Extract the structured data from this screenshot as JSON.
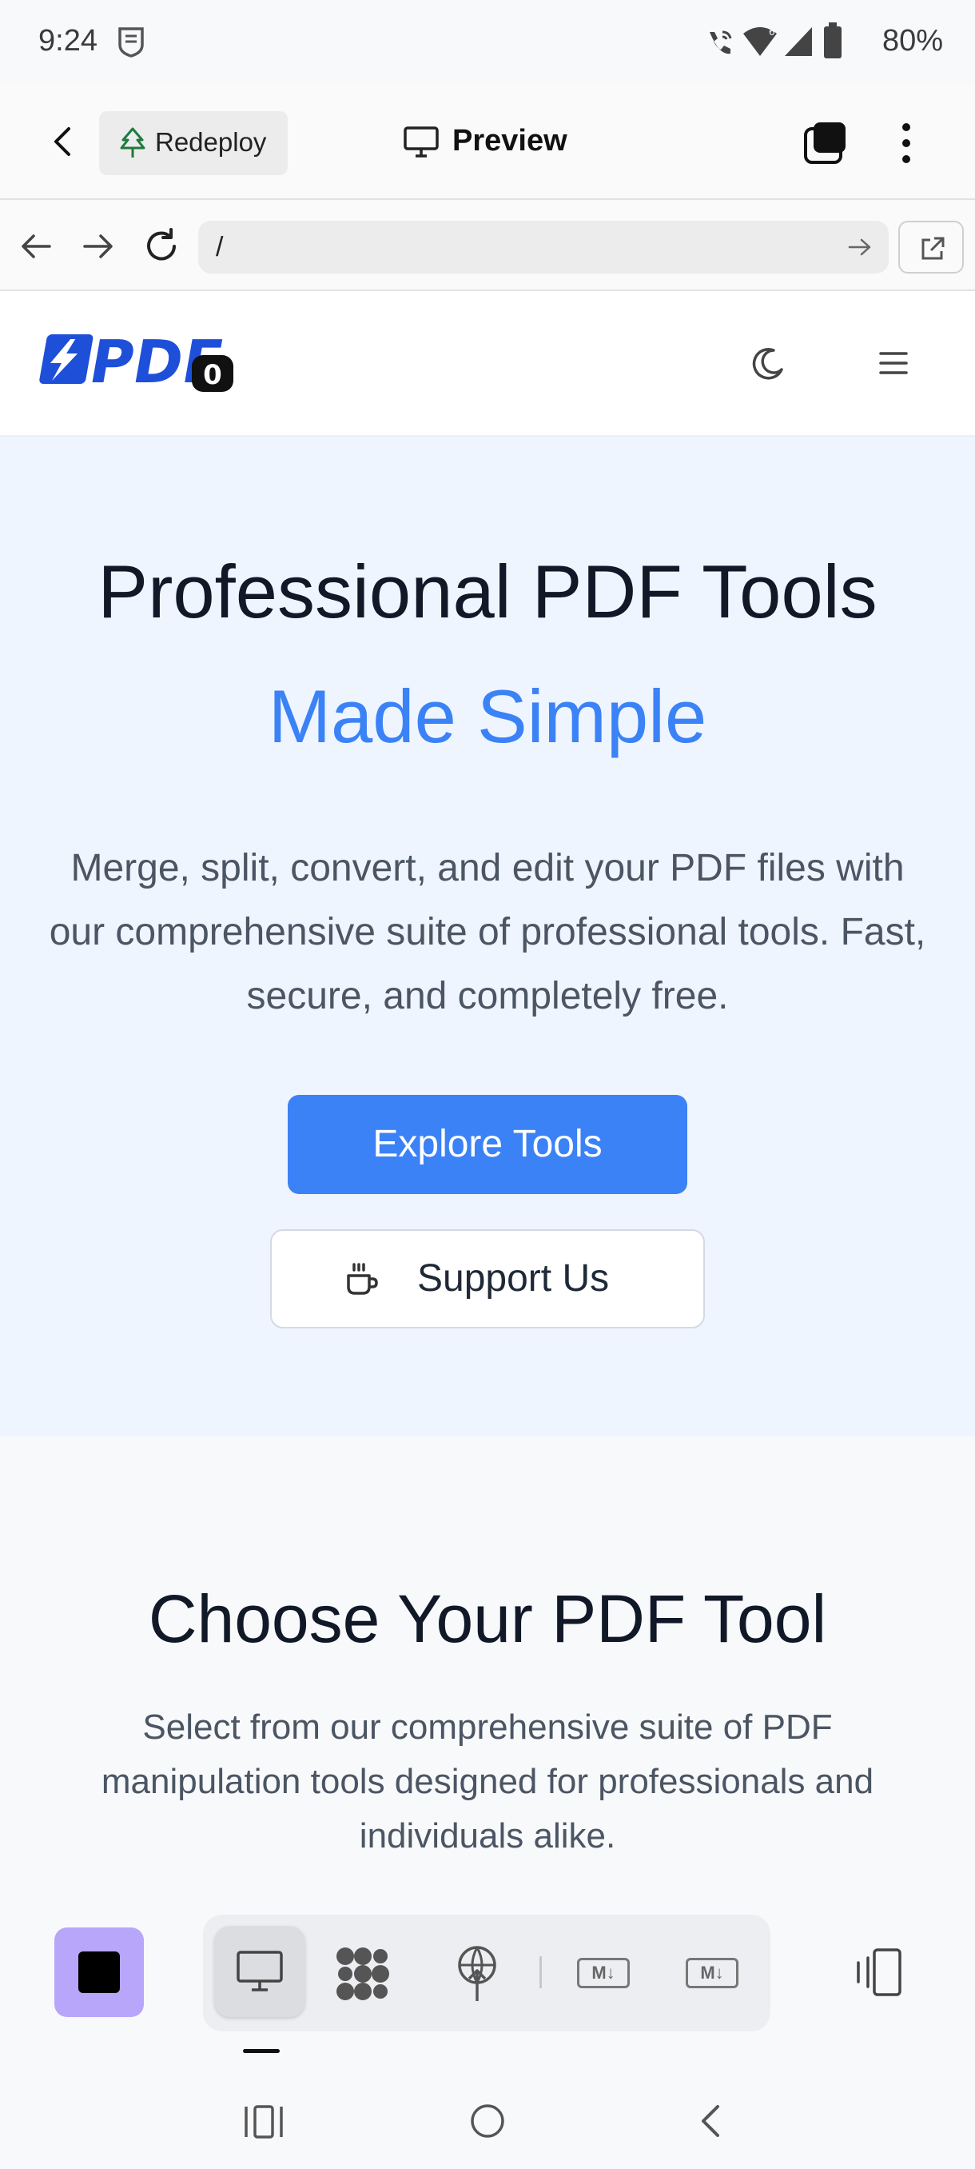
{
  "status_bar": {
    "time": "9:24",
    "battery": "80%",
    "icons": [
      "shield-icon",
      "wifi-calling-icon",
      "wifi-6-icon",
      "signal-icon",
      "battery-icon"
    ]
  },
  "toolbar": {
    "back_icon": "chevron-left-icon",
    "redeploy_label": "Redeploy",
    "preview_label": "Preview",
    "icons": [
      "tree-icon",
      "monitor-icon",
      "tabs-icon",
      "more-vert-icon"
    ]
  },
  "url_bar": {
    "value": "/",
    "icons": [
      "arrow-left-icon",
      "arrow-right-icon",
      "reload-icon",
      "go-arrow-icon",
      "open-external-icon"
    ]
  },
  "site_header": {
    "logo_text": "PDF",
    "logo_badge": "0",
    "brand_color": "#1e4fd8",
    "icons": [
      "moon-icon",
      "menu-icon"
    ]
  },
  "hero": {
    "title": "Professional PDF Tools",
    "accent": "Made Simple",
    "description": "Merge, split, convert, and edit your PDF files with our comprehensive suite of professional tools. Fast, secure, and completely free.",
    "explore_label": "Explore Tools",
    "support_label": "Support Us",
    "accent_color": "#3b82f6"
  },
  "tools_section": {
    "title": "Choose Your PDF Tool",
    "description": "Select from our comprehensive suite of PDF manipulation tools designed for professionals and individuals alike."
  },
  "bottom_bar": {
    "icons": [
      "stop-square-icon",
      "desktop-icon",
      "pattern-icon",
      "globe-upload-icon",
      "markdown-icon",
      "markdown-icon",
      "device-rotate-icon"
    ],
    "markdown_label": "M↓"
  },
  "system_nav": {
    "icons": [
      "recents-icon",
      "home-icon",
      "back-icon"
    ]
  }
}
